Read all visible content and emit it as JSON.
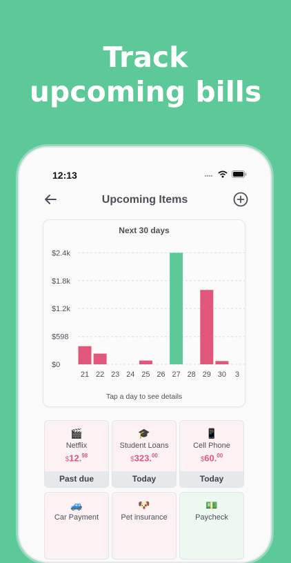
{
  "promo": {
    "line1": "Track",
    "line2": "upcoming bills"
  },
  "status_bar": {
    "time": "12:13",
    "icons": [
      "signal-icon",
      "wifi-icon",
      "battery-icon"
    ]
  },
  "nav": {
    "title": "Upcoming Items",
    "back_icon": "arrow-left-icon",
    "add_icon": "plus-circle-icon"
  },
  "chart_data": {
    "type": "bar",
    "title": "Next 30 days",
    "categories": [
      "21",
      "22",
      "23",
      "24",
      "25",
      "26",
      "27",
      "28",
      "29",
      "30",
      "3"
    ],
    "values": [
      390,
      230,
      0,
      0,
      80,
      0,
      2400,
      0,
      1600,
      70,
      0
    ],
    "highlight_index": 6,
    "colors": {
      "default": "#e0577b",
      "highlight": "#5dc898"
    },
    "y_ticks": [
      "$0",
      "$598",
      "$1.2k",
      "$1.8k",
      "$2.4k"
    ],
    "ylim": [
      0,
      2450
    ],
    "grid": true,
    "hint": "Tap a day to see details"
  },
  "tiles": [
    {
      "icon": "🎬",
      "icon_name": "clapperboard-icon",
      "name": "Netflix",
      "currency": "$",
      "whole": "12.",
      "cents": "98",
      "status": "Past due",
      "bg": "#fcf2f4"
    },
    {
      "icon": "🎓",
      "icon_name": "graduation-cap-icon",
      "name": "Student Loans",
      "currency": "$",
      "whole": "323.",
      "cents": "00",
      "status": "Today",
      "bg": "#fcf2f4"
    },
    {
      "icon": "📱",
      "icon_name": "mobile-phone-icon",
      "name": "Cell Phone",
      "currency": "$",
      "whole": "60.",
      "cents": "00",
      "status": "Today",
      "bg": "#fcf2f4"
    },
    {
      "icon": "🚙",
      "icon_name": "car-icon",
      "name": "Car Payment",
      "bg": "#fcf2f4"
    },
    {
      "icon": "🐶",
      "icon_name": "dog-icon",
      "name": "Pet insurance",
      "bg": "#fcf2f4"
    },
    {
      "icon": "💵",
      "icon_name": "money-icon",
      "name": "Paycheck",
      "bg": "#edf8f1"
    }
  ]
}
